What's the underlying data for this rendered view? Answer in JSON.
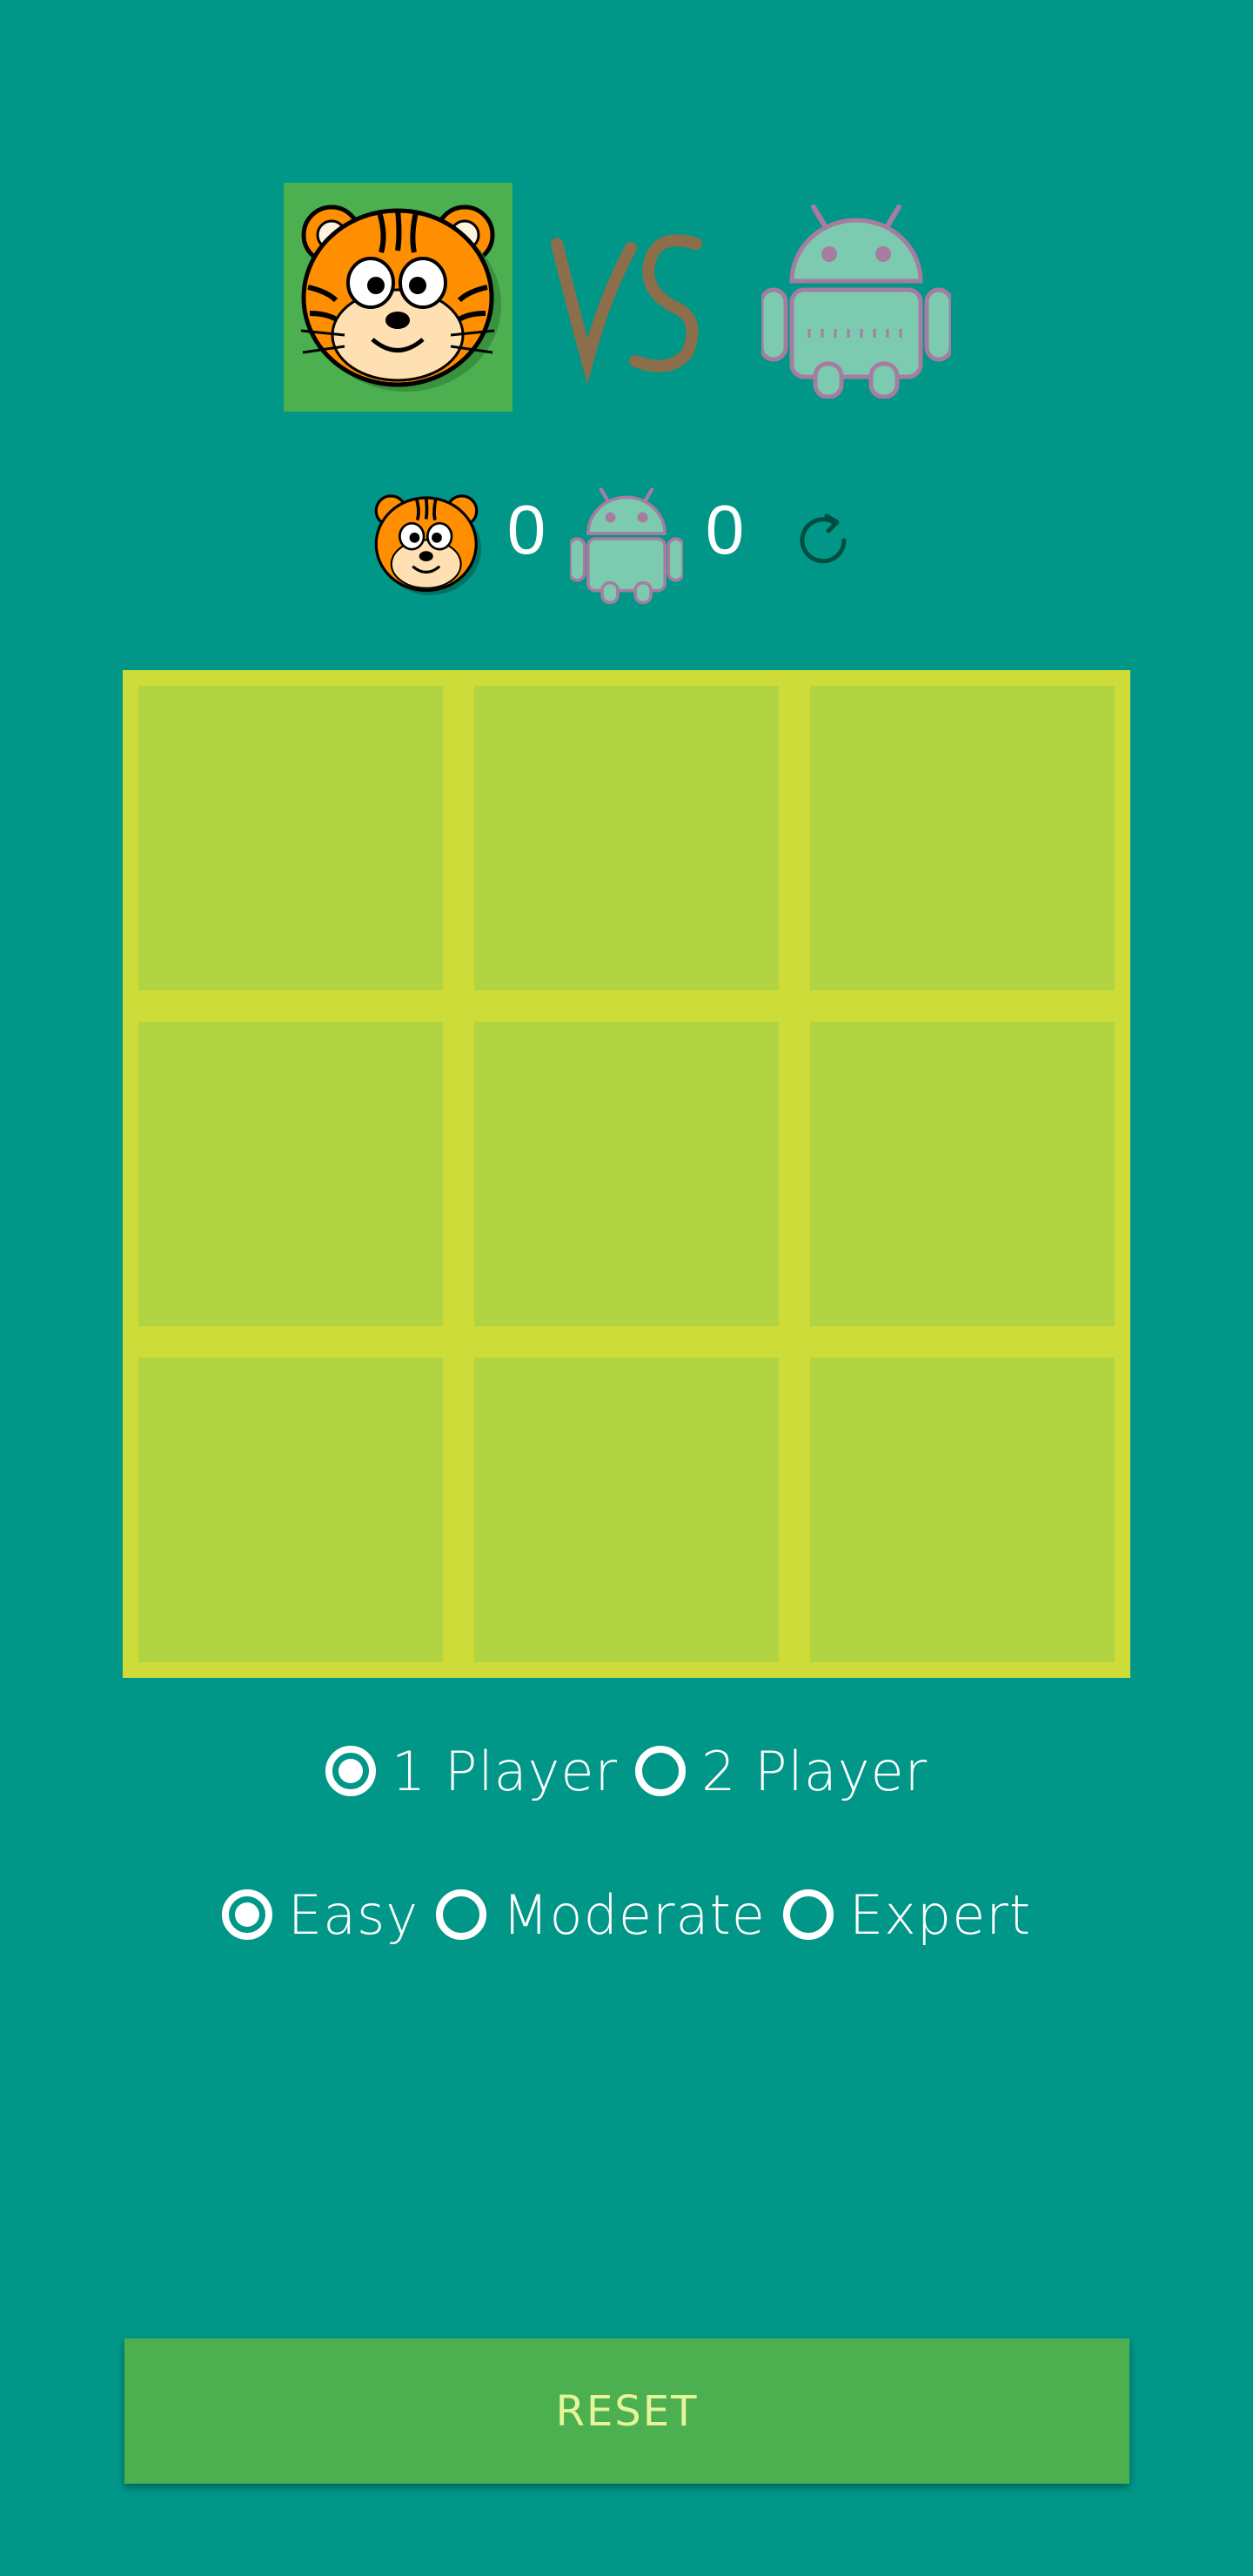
{
  "players": {
    "player1": {
      "name": "tiger",
      "icon": "tiger-face-icon",
      "tile_color": "#4caf50"
    },
    "versus": {
      "icon": "vs-mark-icon",
      "color": "#8d6e4a"
    },
    "player2": {
      "name": "android",
      "icon": "android-robot-icon",
      "color": "#7ccbb0"
    }
  },
  "scoreboard": {
    "player1_score": "0",
    "player2_score": "0",
    "reset_icon": "refresh-icon"
  },
  "board": {
    "cells": [
      "",
      "",
      "",
      "",
      "",
      "",
      "",
      "",
      ""
    ],
    "grid_color": "#cddc39",
    "cell_color": "#b3d442"
  },
  "mode": {
    "options": [
      "1 Player",
      "2 Player"
    ],
    "selected": "1 Player"
  },
  "difficulty": {
    "options": [
      "Easy",
      "Moderate",
      "Expert"
    ],
    "selected": "Easy"
  },
  "reset_button": {
    "label": "RESET"
  },
  "colors": {
    "background": "#009688",
    "accent": "#4caf50",
    "reset_text": "#e6f59a"
  }
}
